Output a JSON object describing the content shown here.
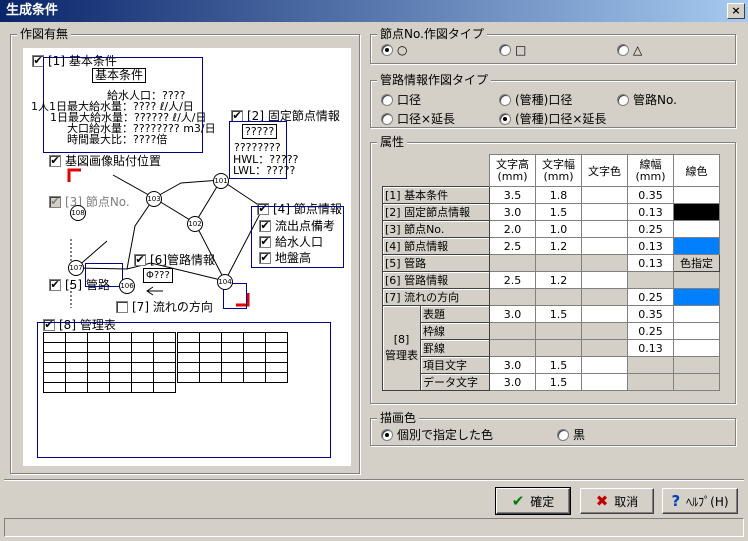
{
  "window": {
    "title": "生成条件",
    "close_label": "×"
  },
  "left_group": {
    "label": "作図有無"
  },
  "diagram": {
    "basic": {
      "check_label": "[1] 基本条件",
      "box_title": "基本条件",
      "lines": [
        "給水人口：????",
        "1人1日最大給水量：???? ℓ/人/日",
        "1日最大給水量：?????? ℓ/人/日",
        "大口給水量：???????? m3/日",
        "時間最大比：????倍"
      ]
    },
    "fixed_node": {
      "check_label": "[2] 固定節点情報",
      "box_title": "?????",
      "v1": "????????",
      "hwl": "HWL：?????",
      "lwl": "LWL：?????"
    },
    "basemap": {
      "check_label": "基図画像貼付位置"
    },
    "node_no": {
      "check_label": "[3] 節点No."
    },
    "node_info": {
      "check_label": "[4] 節点情報",
      "items": [
        "流出点備考",
        "給水人口",
        "地盤高"
      ]
    },
    "pipe": {
      "check_label": "[5] 管路"
    },
    "pipe_info": {
      "check_label": "[6]管路情報",
      "value": "Φ???"
    },
    "flow": {
      "check_label": "[7] 流れの方向"
    },
    "mgmt": {
      "check_label": "[8] 管理表"
    },
    "nodes": [
      "101",
      "102",
      "103",
      "104",
      "106",
      "107",
      "108"
    ]
  },
  "node_type": {
    "label": "節点No.作図タイプ",
    "options": [
      "○",
      "□",
      "△"
    ],
    "selected": 0
  },
  "pipe_type": {
    "label": "管路情報作図タイプ",
    "options": [
      "口径",
      "(管種)口径",
      "管路No.",
      "口径×延長",
      "(管種)口径×延長"
    ],
    "selected": 4
  },
  "attributes": {
    "label": "属性",
    "headers": [
      "文字高\n(mm)",
      "文字幅\n(mm)",
      "文字色",
      "線幅\n(mm)",
      "線色"
    ],
    "rows": [
      {
        "name": "[1] 基本条件",
        "h": "3.5",
        "w": "1.8",
        "lw": "0.35",
        "color": "white"
      },
      {
        "name": "[2] 固定節点情報",
        "h": "3.0",
        "w": "1.5",
        "lw": "0.13",
        "color": "black"
      },
      {
        "name": "[3] 節点No.",
        "h": "2.0",
        "w": "1.0",
        "lw": "0.25",
        "color": "white"
      },
      {
        "name": "[4] 節点情報",
        "h": "2.5",
        "w": "1.2",
        "lw": "0.13",
        "color": "blue"
      },
      {
        "name": "[5] 管路",
        "h": "",
        "w": "",
        "lw": "0.13",
        "color": "button"
      },
      {
        "name": "[6] 管路情報",
        "h": "2.5",
        "w": "1.2",
        "lw": "",
        "color": "gray"
      },
      {
        "name": "[7] 流れの方向",
        "h": "",
        "w": "",
        "lw": "0.25",
        "color": "blue"
      }
    ],
    "mgmt_group": "[8]\n管理表",
    "mgmt_rows": [
      {
        "name": "表題",
        "h": "3.0",
        "w": "1.5",
        "lw": "0.35",
        "color": "white"
      },
      {
        "name": "枠線",
        "h": "",
        "w": "",
        "lw": "0.25",
        "color": "white"
      },
      {
        "name": "罫線",
        "h": "",
        "w": "",
        "lw": "0.13",
        "color": "white"
      },
      {
        "name": "項目文字",
        "h": "3.0",
        "w": "1.5",
        "lw": "",
        "color": "gray"
      },
      {
        "name": "データ文字",
        "h": "3.0",
        "w": "1.5",
        "lw": "",
        "color": "gray"
      }
    ],
    "color_button": "色指定"
  },
  "draw_color": {
    "label": "描画色",
    "options": [
      "個別で指定した色",
      "黒"
    ],
    "selected": 0
  },
  "buttons": {
    "ok": "確定",
    "cancel": "取消",
    "help": "ﾍﾙﾌﾟ(H)"
  },
  "colors": {
    "blue": "#0080ff",
    "black": "#000000"
  }
}
